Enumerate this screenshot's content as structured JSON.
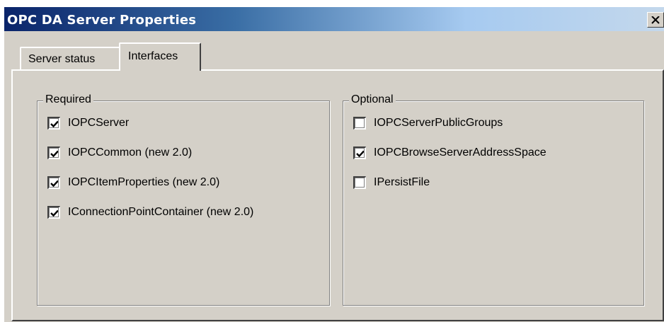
{
  "window": {
    "title": "OPC DA Server Properties",
    "close_icon": "close-icon"
  },
  "tabs": [
    {
      "label": "Server status",
      "selected": false
    },
    {
      "label": "Interfaces",
      "selected": true
    }
  ],
  "required": {
    "legend": "Required",
    "items": [
      {
        "label": "IOPCServer",
        "checked": true
      },
      {
        "label": "IOPCCommon (new 2.0)",
        "checked": true
      },
      {
        "label": "IOPCItemProperties (new 2.0)",
        "checked": true
      },
      {
        "label": "IConnectionPointContainer (new 2.0)",
        "checked": true
      }
    ]
  },
  "optional": {
    "legend": "Optional",
    "items": [
      {
        "label": "IOPCServerPublicGroups",
        "checked": false
      },
      {
        "label": "IOPCBrowseServerAddressSpace",
        "checked": true
      },
      {
        "label": "IPersistFile",
        "checked": false
      }
    ]
  },
  "colors": {
    "titlebar_start": "#0a246a",
    "titlebar_end": "#a6caf0",
    "face": "#d4d0c8"
  }
}
